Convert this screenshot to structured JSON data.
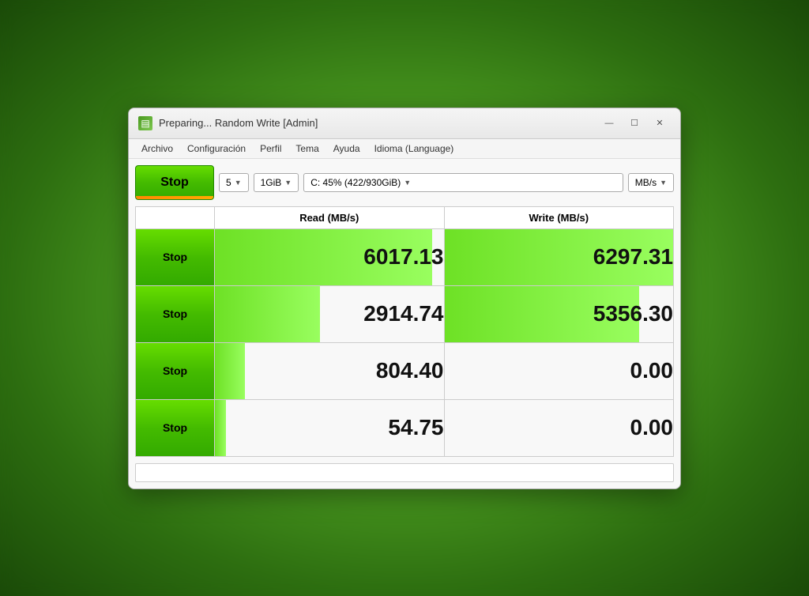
{
  "window": {
    "title": "Preparing... Random Write [Admin]",
    "icon_label": "app-icon"
  },
  "title_controls": {
    "minimize": "—",
    "maximize": "☐",
    "close": "✕"
  },
  "menu": {
    "items": [
      "Archivo",
      "Configuración",
      "Perfil",
      "Tema",
      "Ayuda",
      "Idioma (Language)"
    ]
  },
  "toolbar": {
    "stop_large_label": "Stop",
    "count_value": "5",
    "size_value": "1GiB",
    "drive_value": "C: 45% (422/930GiB)",
    "unit_value": "MB/s"
  },
  "table": {
    "headers": [
      "Read (MB/s)",
      "Write (MB/s)"
    ],
    "rows": [
      {
        "stop_label": "Stop",
        "read": "6017.13",
        "write": "6297.31",
        "read_bar_pct": 95,
        "write_bar_pct": 100
      },
      {
        "stop_label": "Stop",
        "read": "2914.74",
        "write": "5356.30",
        "read_bar_pct": 46,
        "write_bar_pct": 85
      },
      {
        "stop_label": "Stop",
        "read": "804.40",
        "write": "0.00",
        "read_bar_pct": 13,
        "write_bar_pct": 0
      },
      {
        "stop_label": "Stop",
        "read": "54.75",
        "write": "0.00",
        "read_bar_pct": 5,
        "write_bar_pct": 0
      }
    ]
  }
}
